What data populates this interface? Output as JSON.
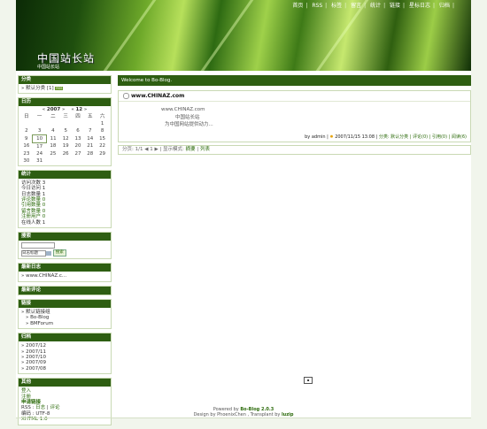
{
  "topnav": [
    "首页",
    "RSS",
    "标签",
    "留言",
    "统计",
    "链接",
    "星标日志",
    "归档"
  ],
  "site": {
    "title": "中国站长站",
    "subtitle": "中国站长站"
  },
  "sidebar": {
    "categories": {
      "header": "分类",
      "item": "默认分类 [1]",
      "rss_badge": "RSS"
    },
    "calendar": {
      "header": "日历",
      "year": "2007",
      "month": "12",
      "prev": "«",
      "next": "»",
      "prev_m": "«",
      "next_m": "»",
      "weekdays": [
        "日",
        "一",
        "二",
        "三",
        "四",
        "五",
        "六"
      ],
      "rows": [
        [
          "",
          "",
          "",
          "",
          "",
          "",
          "1"
        ],
        [
          "2",
          "3",
          "4",
          "5",
          "6",
          "7",
          "8"
        ],
        [
          "9",
          "10",
          "11",
          "12",
          "13",
          "14",
          "15"
        ],
        [
          "16",
          "17",
          "18",
          "19",
          "20",
          "21",
          "22"
        ],
        [
          "23",
          "24",
          "25",
          "26",
          "27",
          "28",
          "29"
        ],
        [
          "30",
          "31",
          "",
          "",
          "",
          "",
          ""
        ]
      ]
    },
    "stats": {
      "header": "统计",
      "items": [
        "访问次数 3",
        "今日访问 1",
        "日志数量 1",
        "评论数量 0",
        "引用数量 0",
        "留言数量 0",
        "注册用户 0",
        "在线人数 1"
      ]
    },
    "search": {
      "header": "搜索",
      "select_value": "日志标题",
      "button": "搜索"
    },
    "recent_posts": {
      "header": "最新日志",
      "item": "www.CHINAZ.c..."
    },
    "recent_comments": {
      "header": "最新评论"
    },
    "links": {
      "header": "链接",
      "group": "默认链接组",
      "items": [
        "Bo-Blog",
        "BMForum"
      ]
    },
    "archives": {
      "header": "归档",
      "items": [
        "2007/12",
        "2007/11",
        "2007/10",
        "2007/09",
        "2007/08"
      ]
    },
    "misc": {
      "header": "其他",
      "items": [
        "登入",
        "注册",
        "申请链接"
      ],
      "rss": "RSS :",
      "rss_log": "日志",
      "rss_comment": "评论",
      "encoding": "编码 : UTF-8",
      "xhtml": "XHTML 1.0"
    }
  },
  "main": {
    "welcome": "Welcome to Bo-Blog.",
    "post": {
      "title": "www.CHINAZ.com",
      "lines": [
        "www.CHINAZ.com",
        "中国站长站",
        "为中国网站提供动力..."
      ],
      "meta_by": "by admin |",
      "meta_date": "2007/11/15 13:08 |",
      "meta_rest": "分类: 默认分类 | 评论(0) | 引用(0) | 阅读(6)"
    },
    "pager": {
      "label": "分页:",
      "pages": "1/1",
      "nav": "◀ 1 ▶",
      "mode": "| 显示模式:",
      "summary": "摘要",
      "list": "列表"
    }
  },
  "footer": {
    "line1_pre": "Powered by",
    "line1_link": "Bo-Blog 2.0.3",
    "line2_pre": "Design by PhoenixChen , Transplant by",
    "line2_link": "luzip"
  },
  "colors": {
    "accent": "#2e5e12",
    "link": "#2b6a0a"
  }
}
